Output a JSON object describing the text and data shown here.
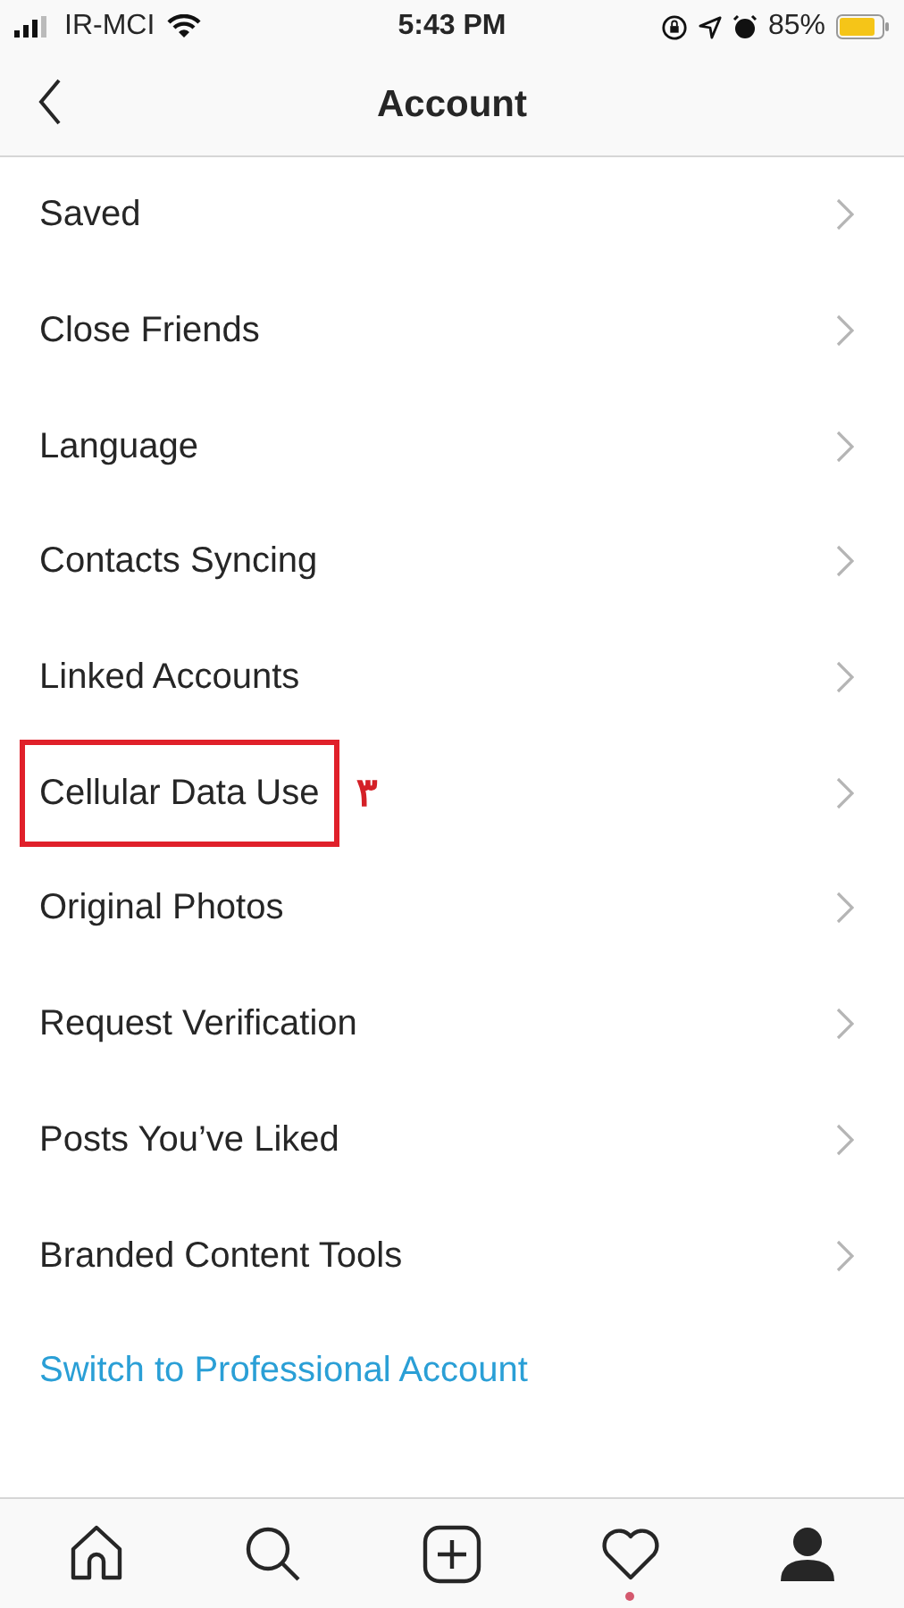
{
  "status_bar": {
    "carrier": "IR-MCI",
    "time": "5:43 PM",
    "battery": "85%"
  },
  "header": {
    "title": "Account"
  },
  "items": [
    {
      "label": "Saved",
      "highlighted": false
    },
    {
      "label": "Close Friends",
      "highlighted": false
    },
    {
      "label": "Language",
      "highlighted": false
    },
    {
      "label": "Contacts Syncing",
      "highlighted": false
    },
    {
      "label": "Linked Accounts",
      "highlighted": false
    },
    {
      "label": "Cellular Data Use",
      "highlighted": true,
      "annotation": "۳"
    },
    {
      "label": "Original Photos",
      "highlighted": false
    },
    {
      "label": "Request Verification",
      "highlighted": false
    },
    {
      "label": "Posts You’ve Liked",
      "highlighted": false
    },
    {
      "label": "Branded Content Tools",
      "highlighted": false
    }
  ],
  "link": "Switch to Professional Account",
  "tab_bar": [
    {
      "kind": "home",
      "badge": false
    },
    {
      "kind": "search",
      "badge": false
    },
    {
      "kind": "add",
      "badge": false
    },
    {
      "kind": "heart",
      "badge": true
    },
    {
      "kind": "profile",
      "badge": false
    }
  ]
}
